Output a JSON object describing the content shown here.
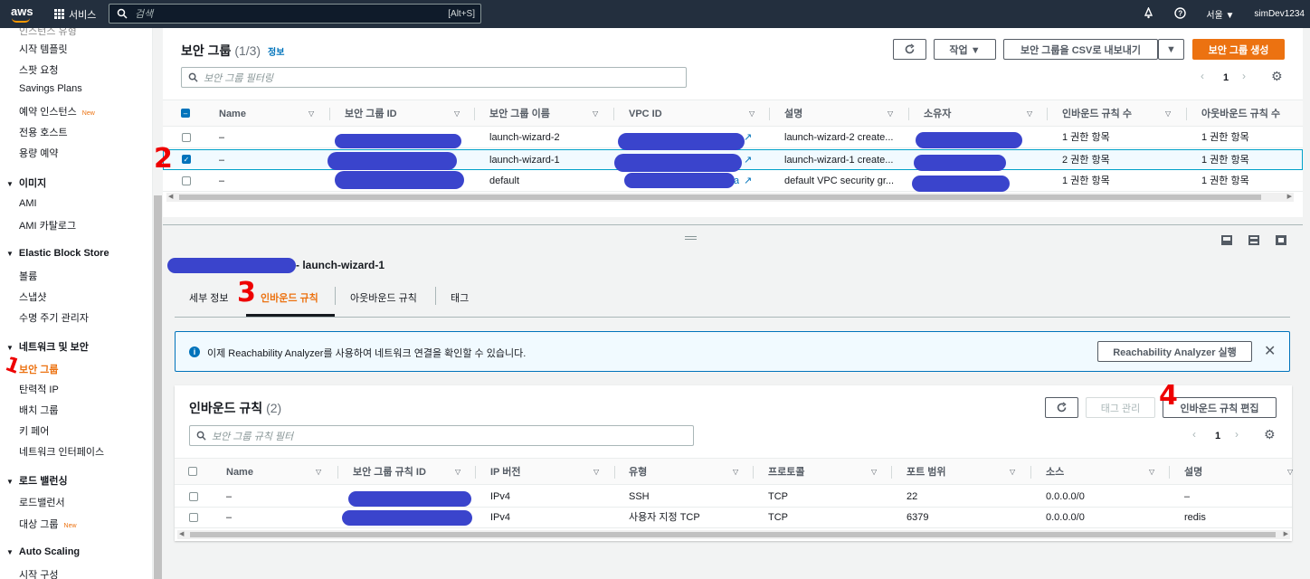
{
  "topbar": {
    "logo": "aws",
    "services": "서비스",
    "search_placeholder": "검색",
    "search_shortcut": "[Alt+S]",
    "region": "서울 ▼",
    "user": "simDev1234"
  },
  "sidebar": {
    "items_top": [
      "시작 템플릿",
      "스팟 요청",
      "Savings Plans",
      "예약 인스턴스",
      "전용 호스트",
      "용량 예약"
    ],
    "new_label": "New",
    "images": {
      "title": "이미지",
      "items": [
        "AMI",
        "AMI 카탈로그"
      ]
    },
    "ebs": {
      "title": "Elastic Block Store",
      "items": [
        "볼륨",
        "스냅샷",
        "수명 주기 관리자"
      ]
    },
    "network": {
      "title": "네트워크 및 보안",
      "items": [
        "보안 그룹",
        "탄력적 IP",
        "배치 그룹",
        "키 페어",
        "네트워크 인터페이스"
      ]
    },
    "lb": {
      "title": "로드 밸런싱",
      "items": [
        "로드밸런서",
        "대상 그룹"
      ]
    },
    "as": {
      "title": "Auto Scaling",
      "items": [
        "시작 구성"
      ]
    }
  },
  "sg_panel": {
    "title": "보안 그룹",
    "count": "(1/3)",
    "info": "정보",
    "actions_label": "작업 ▼",
    "export_label": "보안 그룹을 CSV로 내보내기",
    "create_label": "보안 그룹 생성",
    "filter_placeholder": "보안 그룹 필터링",
    "page": "1",
    "columns": [
      "Name",
      "보안 그룹 ID",
      "보안 그룹 이름",
      "VPC ID",
      "설명",
      "소유자",
      "인바운드 규칙 수",
      "아웃바운드 규칙 수"
    ],
    "rows": [
      {
        "name": "–",
        "group_name": "launch-wizard-2",
        "description": "launch-wizard-2 create...",
        "inbound": "1 권한 항목",
        "outbound": "1 권한 항목",
        "selected": false
      },
      {
        "name": "–",
        "group_name": "launch-wizard-1",
        "description": "launch-wizard-1 create...",
        "inbound": "2 권한 항목",
        "outbound": "1 권한 항목",
        "selected": true
      },
      {
        "name": "–",
        "group_name": "default",
        "description": "default VPC security gr...",
        "inbound": "1 권한 항목",
        "outbound": "1 권한 항목",
        "selected": false
      }
    ],
    "vpc_fragment": "a"
  },
  "detail": {
    "title_suffix": "- launch-wizard-1",
    "tabs": [
      "세부 정보",
      "인바운드 규칙",
      "아웃바운드 규칙",
      "태그"
    ],
    "info_text": "이제 Reachability Analyzer를 사용하여 네트워크 연결을 확인할 수 있습니다.",
    "info_button": "Reachability Analyzer 실행",
    "rules_title": "인바운드 규칙",
    "rules_count": "(2)",
    "manage_tags": "태그 관리",
    "edit_rules": "인바운드 규칙 편집",
    "filter_placeholder": "보안 그룹 규칙 필터",
    "page": "1",
    "columns": [
      "Name",
      "보안 그룹 규칙 ID",
      "IP 버전",
      "유형",
      "프로토콜",
      "포트 범위",
      "소스",
      "설명"
    ],
    "rows": [
      {
        "name": "–",
        "ip": "IPv4",
        "type": "SSH",
        "protocol": "TCP",
        "port": "22",
        "source": "0.0.0.0/0",
        "desc": "–"
      },
      {
        "name": "–",
        "ip": "IPv4",
        "type": "사용자 지정 TCP",
        "protocol": "TCP",
        "port": "6379",
        "source": "0.0.0.0/0",
        "desc": "redis"
      }
    ]
  },
  "annotations": [
    "1",
    "2",
    "3",
    "4"
  ]
}
